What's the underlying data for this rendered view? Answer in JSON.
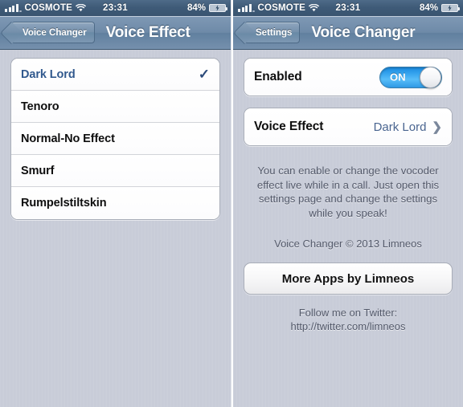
{
  "colors": {
    "page_background": "#c9cdd9",
    "navbar_blue": "#6e8aa8",
    "statusbar_blue": "#3f5b78",
    "accent_blue": "#31598e",
    "toggle_on_blue": "#3aa8f0",
    "row_white": "#ffffff",
    "muted_text": "#53596a"
  },
  "left_panel": {
    "status_bar": {
      "signal_icon": "signal-bars-icon",
      "carrier": "COSMOTE",
      "wifi_icon": "wifi-icon",
      "time": "23:31",
      "battery_percent": "84%",
      "battery_icon": "battery-charging-icon"
    },
    "nav": {
      "back_label": "Voice Changer",
      "back_icon": "back-chevron-icon",
      "title": "Voice Effect"
    },
    "list": {
      "checkmark_glyph": "✓",
      "items": [
        {
          "label": "Dark Lord",
          "selected": true
        },
        {
          "label": "Tenoro",
          "selected": false
        },
        {
          "label": "Normal-No Effect",
          "selected": false
        },
        {
          "label": "Smurf",
          "selected": false
        },
        {
          "label": "Rumpelstiltskin",
          "selected": false
        }
      ]
    }
  },
  "right_panel": {
    "status_bar": {
      "signal_icon": "signal-bars-icon",
      "carrier": "COSMOTE",
      "wifi_icon": "wifi-icon",
      "time": "23:31",
      "battery_percent": "84%",
      "battery_icon": "battery-charging-icon"
    },
    "nav": {
      "back_label": "Settings",
      "back_icon": "back-chevron-icon",
      "title": "Voice Changer"
    },
    "enabled_row": {
      "label": "Enabled",
      "toggle_state": "ON"
    },
    "voice_effect_row": {
      "label": "Voice Effect",
      "value": "Dark Lord",
      "chevron_glyph": "❯"
    },
    "description": "You can enable or change the vocoder effect live while in a call. Just open this settings page and change the settings while you speak!",
    "copyright": "Voice Changer © 2013 Limneos",
    "more_apps_button": "More Apps by Limneos",
    "footer_line_1": "Follow me on Twitter:",
    "footer_line_2": "http://twitter.com/limneos"
  }
}
